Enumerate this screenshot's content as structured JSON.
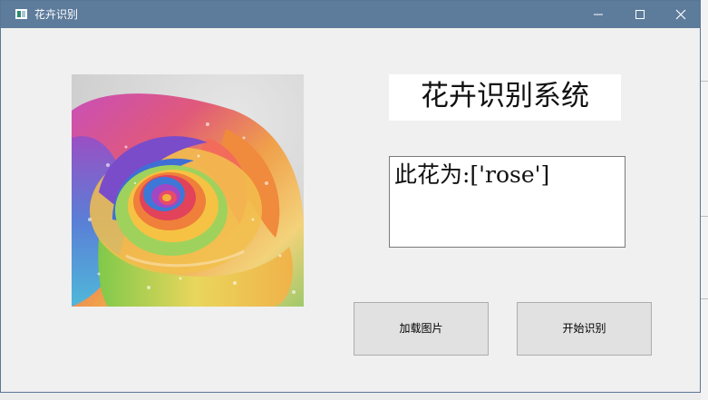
{
  "window": {
    "title": "花卉识别",
    "controls": {
      "minimize_icon": "minimize-icon",
      "maximize_icon": "maximize-icon",
      "close_icon": "close-icon"
    }
  },
  "main": {
    "heading": "花卉识别系统",
    "result_text": "此花为:['rose']",
    "image_subject": "rainbow-rose"
  },
  "buttons": {
    "load_image_label": "加载图片",
    "start_recognition_label": "开始识别"
  },
  "colors": {
    "titlebar": "#5d7b9b",
    "window_bg": "#f0f0f0",
    "button_bg": "#e1e1e1"
  }
}
